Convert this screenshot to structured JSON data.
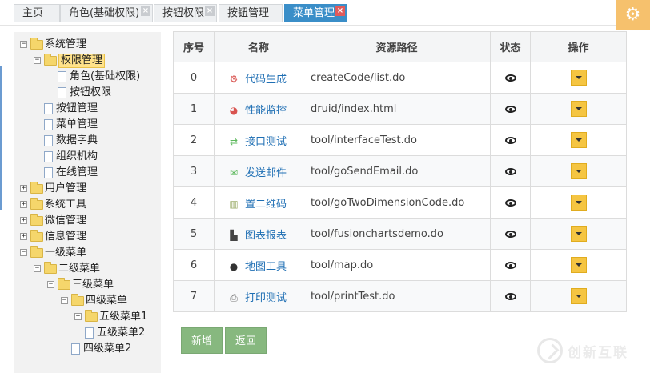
{
  "tabs": [
    {
      "label": "主页",
      "closable": false,
      "active": false
    },
    {
      "label": "角色(基础权限)",
      "closable": true,
      "active": false
    },
    {
      "label": "按钮权限",
      "closable": true,
      "active": false
    },
    {
      "label": "按钮管理",
      "closable": false,
      "active": false
    },
    {
      "label": "菜单管理",
      "closable": true,
      "active": true
    }
  ],
  "tab_close_glyph": "×",
  "settings_icon": "gear-icon",
  "tree": [
    {
      "label": "系统管理",
      "type": "folder",
      "expanded": true,
      "level": 0
    },
    {
      "label": "权限管理",
      "type": "folder",
      "expanded": true,
      "level": 1,
      "selected": true
    },
    {
      "label": "角色(基础权限)",
      "type": "file",
      "level": 2
    },
    {
      "label": "按钮权限",
      "type": "file",
      "level": 2
    },
    {
      "label": "按钮管理",
      "type": "file",
      "level": 1
    },
    {
      "label": "菜单管理",
      "type": "file",
      "level": 1
    },
    {
      "label": "数据字典",
      "type": "file",
      "level": 1
    },
    {
      "label": "组织机构",
      "type": "file",
      "level": 1
    },
    {
      "label": "在线管理",
      "type": "file",
      "level": 1
    },
    {
      "label": "用户管理",
      "type": "folder",
      "expanded": false,
      "level": 0
    },
    {
      "label": "系统工具",
      "type": "folder",
      "expanded": false,
      "level": 0
    },
    {
      "label": "微信管理",
      "type": "folder",
      "expanded": false,
      "level": 0
    },
    {
      "label": "信息管理",
      "type": "folder",
      "expanded": false,
      "level": 0
    },
    {
      "label": "一级菜单",
      "type": "folder",
      "expanded": true,
      "level": 0
    },
    {
      "label": "二级菜单",
      "type": "folder",
      "expanded": true,
      "level": 1
    },
    {
      "label": "三级菜单",
      "type": "folder",
      "expanded": true,
      "level": 2
    },
    {
      "label": "四级菜单",
      "type": "folder",
      "expanded": true,
      "level": 3
    },
    {
      "label": "五级菜单1",
      "type": "folder",
      "expanded": false,
      "level": 4
    },
    {
      "label": "五级菜单2",
      "type": "file",
      "level": 4
    },
    {
      "label": "四级菜单2",
      "type": "file",
      "level": 3
    }
  ],
  "table": {
    "headers": [
      "序号",
      "名称",
      "资源路径",
      "状态",
      "操作"
    ],
    "rows": [
      {
        "index": "0",
        "icon": "cogs-icon",
        "glyph": "⚙",
        "icon_color": "#d9534f",
        "name": "代码生成",
        "path": "createCode/list.do"
      },
      {
        "index": "1",
        "icon": "dashboard-icon",
        "glyph": "◕",
        "icon_color": "#d9534f",
        "name": "性能监控",
        "path": "druid/index.html"
      },
      {
        "index": "2",
        "icon": "exchange-icon",
        "glyph": "⇄",
        "icon_color": "#5cb85c",
        "name": "接口测试",
        "path": "tool/interfaceTest.do"
      },
      {
        "index": "3",
        "icon": "envelope-icon",
        "glyph": "✉",
        "icon_color": "#5cb85c",
        "name": "发送邮件",
        "path": "tool/goSendEmail.do"
      },
      {
        "index": "4",
        "icon": "barcode-icon",
        "glyph": "▥",
        "icon_color": "#a0b070",
        "name": "置二维码",
        "path": "tool/goTwoDimensionCode.do"
      },
      {
        "index": "5",
        "icon": "bar-chart-icon",
        "glyph": "▙",
        "icon_color": "#444444",
        "name": "图表报表",
        "path": "tool/fusionchartsdemo.do"
      },
      {
        "index": "6",
        "icon": "globe-icon",
        "glyph": "●",
        "icon_color": "#333333",
        "name": "地图工具",
        "path": "tool/map.do"
      },
      {
        "index": "7",
        "icon": "print-icon",
        "glyph": "⎙",
        "icon_color": "#777777",
        "name": "打印测试",
        "path": "tool/printTest.do"
      }
    ]
  },
  "buttons": {
    "add_label": "新增",
    "back_label": "返回"
  },
  "watermark": {
    "text": "创新互联"
  }
}
